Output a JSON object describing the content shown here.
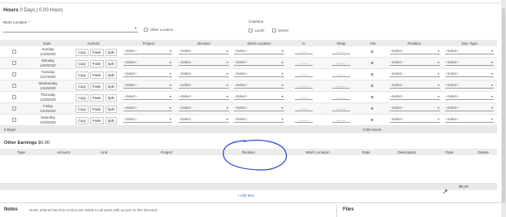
{
  "hours": {
    "title": "Hours",
    "summary": "0 Days | 0.00 Hours"
  },
  "work_location": {
    "label": "Work Location",
    "required_mark": "*",
    "other_location_label": "Other Location"
  },
  "columns": {
    "label": "Columns",
    "lunch": "Lunch",
    "dinner": "Dinner"
  },
  "table": {
    "headers": [
      "Date",
      "Actions",
      "Project",
      "Division",
      "Work Location",
      "In",
      "Wrap",
      "Hrs",
      "Position",
      "Day Type"
    ],
    "select_placeholder": "--Select--",
    "time_placeholder": "__:__",
    "actions": [
      "Copy",
      "Paste",
      "Split"
    ],
    "rows": [
      {
        "day": "Sunday",
        "date": "1/19/2020",
        "hrs": "0"
      },
      {
        "day": "Monday",
        "date": "1/20/2020",
        "hrs": "0"
      },
      {
        "day": "Tuesday",
        "date": "1/21/2020",
        "hrs": "0"
      },
      {
        "day": "Wednesday",
        "date": "1/22/2020",
        "hrs": "0"
      },
      {
        "day": "Thursday",
        "date": "1/23/2020",
        "hrs": "0"
      },
      {
        "day": "Friday",
        "date": "1/24/2020",
        "hrs": "0"
      },
      {
        "day": "Saturday",
        "date": "1/25/2020",
        "hrs": "0"
      }
    ],
    "total_days": "0 Days",
    "total_hours": "0.00 Hours"
  },
  "other_earnings": {
    "title": "Other Earnings",
    "amount": "$0.00",
    "headers": [
      "Type",
      "Amount",
      "Unit",
      "Project",
      "Division",
      "Work Location",
      "Rate",
      "Description",
      "Total",
      "Delete"
    ],
    "footer_total": "$0.00",
    "add_item": "+ Add Item"
  },
  "notes": {
    "title": "Notes",
    "text": "Notes entered into this section are visible to all users with access to this timecard."
  },
  "files": {
    "title": "Files"
  },
  "colors": {
    "annotation": "#1f3fd0",
    "link": "#2f6fb3"
  }
}
